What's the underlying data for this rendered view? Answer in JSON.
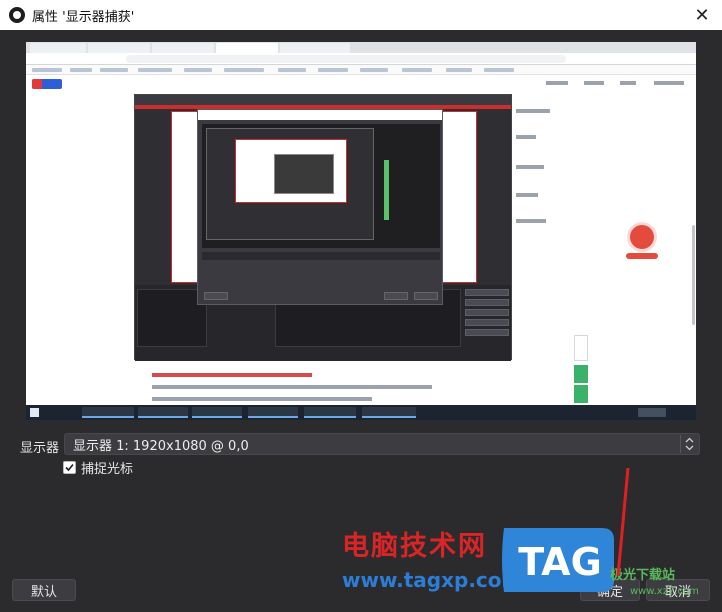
{
  "window": {
    "title": "属性 '显示器捕获'",
    "close_glyph": "✕"
  },
  "form": {
    "display_label": "显示器",
    "display_value": "显示器 1: 1920x1080 @ 0,0",
    "capture_cursor_label": "捕捉光标",
    "capture_cursor_checked": true
  },
  "buttons": {
    "default_label": "默认",
    "ok_label": "确定",
    "cancel_label": "取消"
  },
  "watermark": {
    "site_name": "电脑技术网",
    "url": "www.tagxp.com",
    "tag_text": "TAG",
    "side_text": "极光下载站",
    "side_url": "www.xz7.com"
  },
  "colors": {
    "dialog_bg": "#2b2b2e",
    "control_bg": "#3c3c41",
    "watermark_red": "#d92525",
    "watermark_blue": "#2c7dd6"
  },
  "icons": {
    "app": "obs-logo-icon",
    "close": "close-icon",
    "checkbox": "checkmark-icon",
    "select": "chevron-updown-icon"
  }
}
